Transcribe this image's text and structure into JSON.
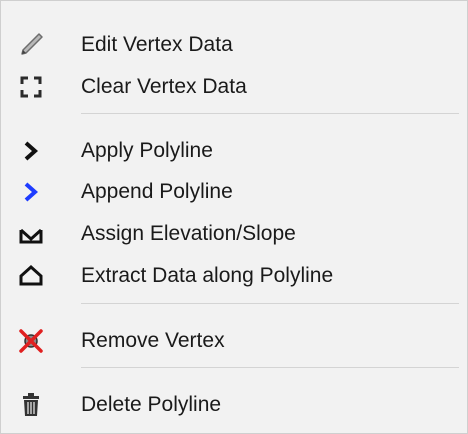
{
  "menu": {
    "items": [
      {
        "label": "Edit Vertex Data",
        "icon": "pencil-icon"
      },
      {
        "label": "Clear Vertex Data",
        "icon": "selection-corners-icon"
      },
      {
        "label": "Apply Polyline",
        "icon": "chevron-right-icon"
      },
      {
        "label": "Append Polyline",
        "icon": "chevron-right-blue-icon"
      },
      {
        "label": "Assign Elevation/Slope",
        "icon": "assign-elevation-icon"
      },
      {
        "label": "Extract Data along Polyline",
        "icon": "extract-profile-icon"
      },
      {
        "label": "Remove Vertex",
        "icon": "remove-vertex-icon"
      },
      {
        "label": "Delete Polyline",
        "icon": "trash-icon"
      }
    ]
  },
  "colors": {
    "background": "#f2f2f2",
    "text": "#1a1a1a",
    "accent_blue": "#1e3cff",
    "remove_red": "#e02020"
  }
}
